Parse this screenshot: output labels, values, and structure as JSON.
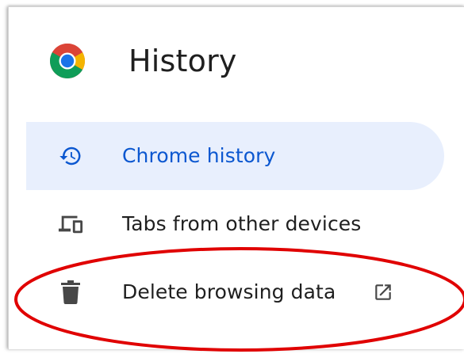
{
  "header": {
    "title": "History",
    "logo_icon": "chrome-logo-icon"
  },
  "nav": {
    "items": [
      {
        "label": "Chrome history",
        "icon": "history-icon",
        "active": true
      },
      {
        "label": "Tabs from other devices",
        "icon": "devices-icon",
        "active": false
      },
      {
        "label": "Delete browsing data",
        "icon": "trash-icon",
        "trailing_icon": "open-in-new-icon",
        "active": false
      }
    ]
  },
  "colors": {
    "accent": "#0b57d0",
    "active_background": "#e8effd",
    "text": "#1f1f1f",
    "icon": "#474747",
    "annotation_circle": "#e00000"
  }
}
